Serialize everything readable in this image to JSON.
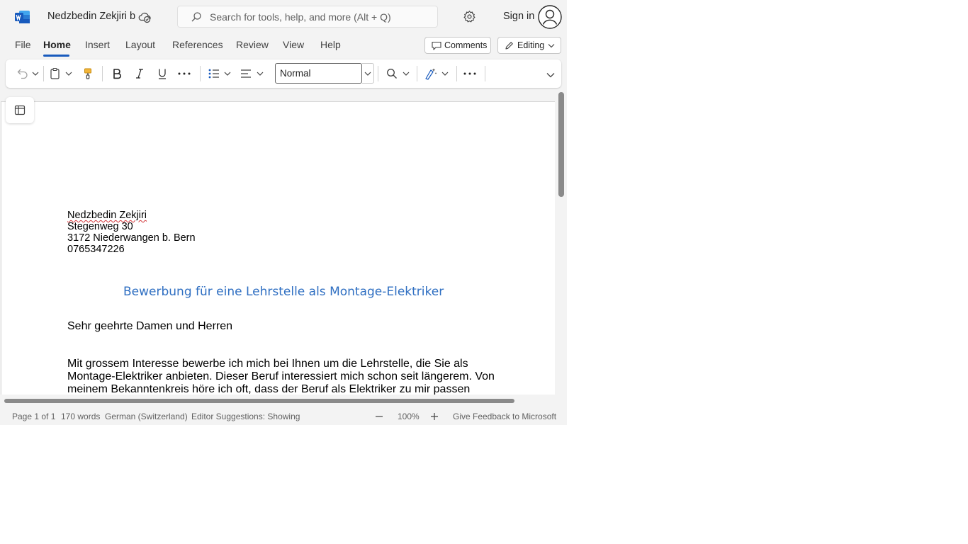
{
  "titlebar": {
    "doc_title": "Nedzbedin Zekjiri b",
    "search_placeholder": "Search for tools, help, and more (Alt + Q)",
    "sign_in": "Sign in"
  },
  "menubar": {
    "items": [
      "File",
      "Home",
      "Insert",
      "Layout",
      "References",
      "Review",
      "View",
      "Help"
    ],
    "active": "Home",
    "comments_label": "Comments",
    "editing_label": "Editing"
  },
  "ribbon": {
    "style_value": "Normal"
  },
  "document": {
    "address": [
      "Nedzbedin Zekjiri",
      "Stegenweg 30",
      "3172 Niederwangen b. Bern",
      "0765347226"
    ],
    "heading": "Bewerbung für eine Lehrstelle als Montage-Elektriker",
    "salutation": "Sehr geehrte Damen und Herren",
    "body_lines": [
      "Mit grossem Interesse bewerbe ich mich bei Ihnen um die Lehrstelle, die Sie als",
      "Montage-Elektriker anbieten. Dieser Beruf interessiert mich schon seit längerem. Von",
      "meinem Bekanntenkreis höre ich oft, dass der Beruf als Elektriker zu mir passen"
    ]
  },
  "statusbar": {
    "page": "Page 1 of 1",
    "words": "170 words",
    "language": "German (Switzerland)",
    "editor": "Editor Suggestions: Showing",
    "zoom": "100%",
    "feedback": "Give Feedback to Microsoft"
  },
  "colors": {
    "accent": "#185abd",
    "heading": "#2f6fc2",
    "spellcheck": "#d13438",
    "format_painter": "#c68a0d"
  },
  "icons": [
    "word-logo-icon",
    "cloud-sync-icon",
    "search-icon",
    "gear-icon",
    "avatar-icon",
    "comment-icon",
    "pencil-icon",
    "undo-icon",
    "clipboard-icon",
    "format-painter-icon",
    "bold-icon",
    "italic-icon",
    "underline-icon",
    "more-icon",
    "bullets-icon",
    "align-icon",
    "find-icon",
    "designer-icon",
    "chevron-down-icon",
    "nav-pane-icon",
    "minus-icon",
    "plus-icon"
  ]
}
